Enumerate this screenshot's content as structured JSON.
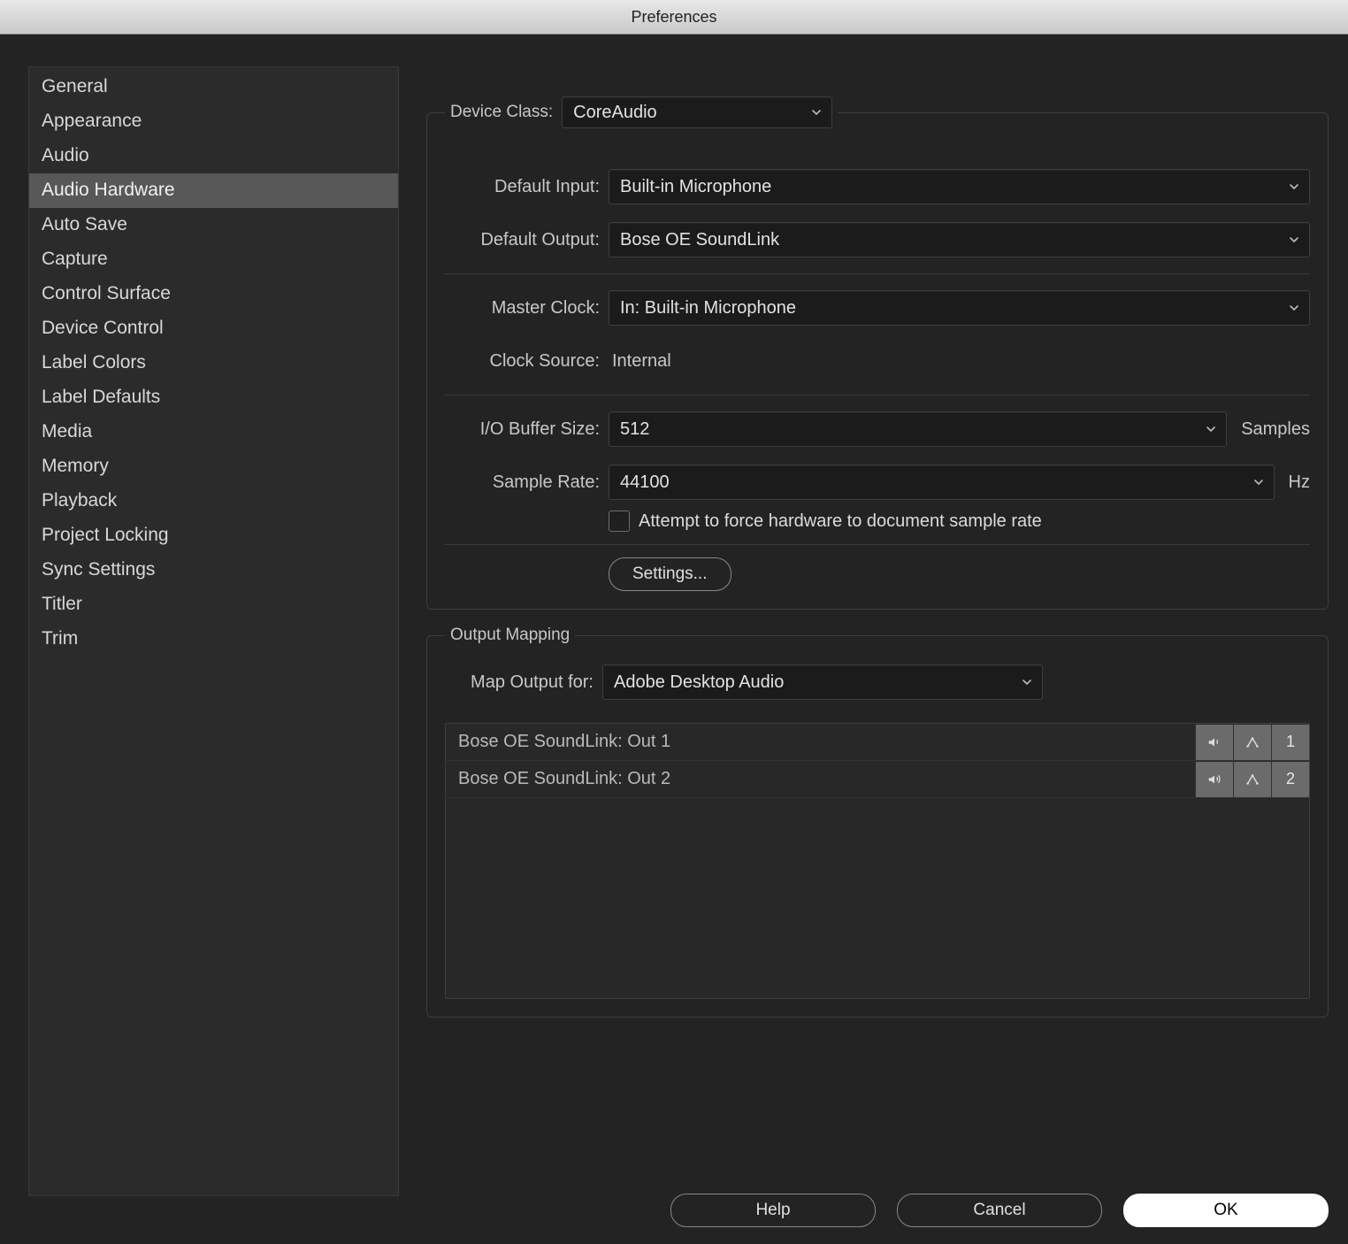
{
  "window": {
    "title": "Preferences"
  },
  "sidebar": {
    "items": [
      "General",
      "Appearance",
      "Audio",
      "Audio Hardware",
      "Auto Save",
      "Capture",
      "Control Surface",
      "Device Control",
      "Label Colors",
      "Label Defaults",
      "Media",
      "Memory",
      "Playback",
      "Project Locking",
      "Sync Settings",
      "Titler",
      "Trim"
    ],
    "selected_index": 3
  },
  "device": {
    "device_class_label": "Device Class:",
    "device_class_value": "CoreAudio",
    "default_input_label": "Default Input:",
    "default_input_value": "Built-in Microphone",
    "default_output_label": "Default Output:",
    "default_output_value": "Bose OE SoundLink",
    "master_clock_label": "Master Clock:",
    "master_clock_value": "In: Built-in Microphone",
    "clock_source_label": "Clock Source:",
    "clock_source_value": "Internal",
    "io_buffer_label": "I/O Buffer Size:",
    "io_buffer_value": "512",
    "io_buffer_suffix": "Samples",
    "sample_rate_label": "Sample Rate:",
    "sample_rate_value": "44100",
    "sample_rate_suffix": "Hz",
    "force_checkbox_label": "Attempt to force hardware to document sample rate",
    "settings_button": "Settings..."
  },
  "output_mapping": {
    "legend": "Output Mapping",
    "map_output_label": "Map Output for:",
    "map_output_value": "Adobe Desktop Audio",
    "rows": [
      {
        "name": "Bose OE SoundLink: Out 1",
        "number": "1"
      },
      {
        "name": "Bose OE SoundLink: Out 2",
        "number": "2"
      }
    ]
  },
  "footer": {
    "help": "Help",
    "cancel": "Cancel",
    "ok": "OK"
  }
}
